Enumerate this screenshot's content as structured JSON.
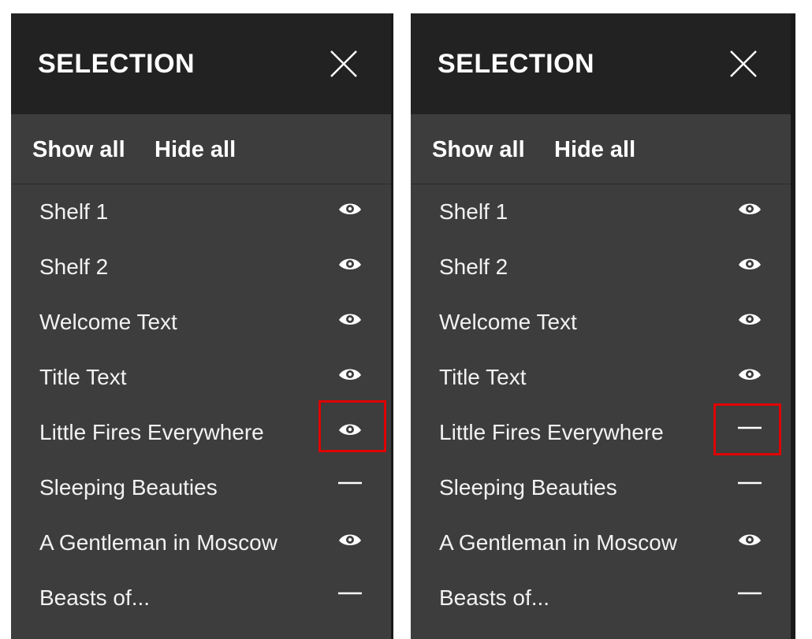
{
  "panels": [
    {
      "title": "SELECTION",
      "show_all_label": "Show all",
      "hide_all_label": "Hide all",
      "items": [
        {
          "label": "Shelf 1",
          "visibility": "visible",
          "icon": "eye-icon"
        },
        {
          "label": "Shelf 2",
          "visibility": "visible",
          "icon": "eye-icon"
        },
        {
          "label": "Welcome Text",
          "visibility": "visible",
          "icon": "eye-icon"
        },
        {
          "label": "Title Text",
          "visibility": "visible",
          "icon": "eye-icon"
        },
        {
          "label": "Little Fires Everywhere",
          "visibility": "visible",
          "icon": "eye-icon",
          "highlighted": true
        },
        {
          "label": "Sleeping Beauties",
          "visibility": "hidden",
          "icon": "dash-icon"
        },
        {
          "label": "A Gentleman in Moscow",
          "visibility": "visible",
          "icon": "eye-icon"
        },
        {
          "label": "Beasts of...",
          "visibility": "hidden",
          "icon": "dash-icon"
        }
      ]
    },
    {
      "title": "SELECTION",
      "show_all_label": "Show all",
      "hide_all_label": "Hide all",
      "items": [
        {
          "label": "Shelf 1",
          "visibility": "visible",
          "icon": "eye-icon"
        },
        {
          "label": "Shelf 2",
          "visibility": "visible",
          "icon": "eye-icon"
        },
        {
          "label": "Welcome Text",
          "visibility": "visible",
          "icon": "eye-icon"
        },
        {
          "label": "Title Text",
          "visibility": "visible",
          "icon": "eye-icon"
        },
        {
          "label": "Little Fires Everywhere",
          "visibility": "hidden",
          "icon": "dash-icon",
          "highlighted": true
        },
        {
          "label": "Sleeping Beauties",
          "visibility": "hidden",
          "icon": "dash-icon"
        },
        {
          "label": "A Gentleman in Moscow",
          "visibility": "visible",
          "icon": "eye-icon"
        },
        {
          "label": "Beasts of...",
          "visibility": "hidden",
          "icon": "dash-icon"
        }
      ]
    }
  ],
  "colors": {
    "header_bg": "#222222",
    "panel_bg": "#3d3d3d",
    "text": "#ffffff",
    "highlight": "#e00000"
  }
}
